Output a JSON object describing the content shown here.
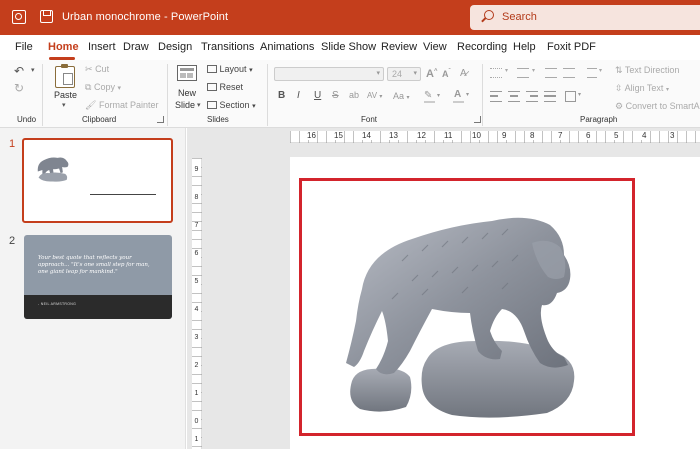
{
  "titlebar": {
    "document_name": "Urban monochrome",
    "separator": "-",
    "app_name": "PowerPoint",
    "search_placeholder": "Search",
    "brand_color": "#c43e1c"
  },
  "tabs": [
    {
      "label": "File"
    },
    {
      "label": "Home",
      "active": true
    },
    {
      "label": "Insert"
    },
    {
      "label": "Draw"
    },
    {
      "label": "Design"
    },
    {
      "label": "Transitions"
    },
    {
      "label": "Animations"
    },
    {
      "label": "Slide Show"
    },
    {
      "label": "Review"
    },
    {
      "label": "View"
    },
    {
      "label": "Recording"
    },
    {
      "label": "Help"
    },
    {
      "label": "Foxit PDF"
    }
  ],
  "ribbon": {
    "undo_group": {
      "label": "Undo"
    },
    "clipboard": {
      "label": "Clipboard",
      "paste": "Paste",
      "cut": "Cut",
      "copy": "Copy",
      "format_painter": "Format Painter"
    },
    "slides": {
      "label": "Slides",
      "new_slide_line1": "New",
      "new_slide_line2": "Slide",
      "layout": "Layout",
      "reset": "Reset",
      "section": "Section"
    },
    "font": {
      "label": "Font",
      "size": "24",
      "bold": "B",
      "italic": "I",
      "underline": "U",
      "strike": "S",
      "spacing": "AV",
      "case": "Aa",
      "grow": "A",
      "shrink": "A",
      "font_color": "A"
    },
    "paragraph": {
      "label": "Paragraph",
      "text_direction": "Text Direction",
      "align_text": "Align Text",
      "convert_smartart": "Convert to SmartArt"
    }
  },
  "thumbnails": [
    {
      "number": "1",
      "selected": true
    },
    {
      "number": "2",
      "selected": false,
      "quote": "Your best quote that reflects your approach... \"It's one small step for man, one giant leap for mankind.\"",
      "author": "- NEIL ARMSTRONG"
    }
  ],
  "rulers": {
    "horizontal": [
      "16",
      "15",
      "14",
      "13",
      "12",
      "11",
      "10",
      "9",
      "8",
      "7",
      "6",
      "5",
      "4",
      "3"
    ],
    "vertical": [
      "9",
      "8",
      "7",
      "6",
      "5",
      "4",
      "3",
      "2",
      "1",
      "0",
      "1",
      "2"
    ]
  },
  "slide": {
    "frame_color": "#d3242c",
    "image": "bear-statue-3d-model"
  }
}
